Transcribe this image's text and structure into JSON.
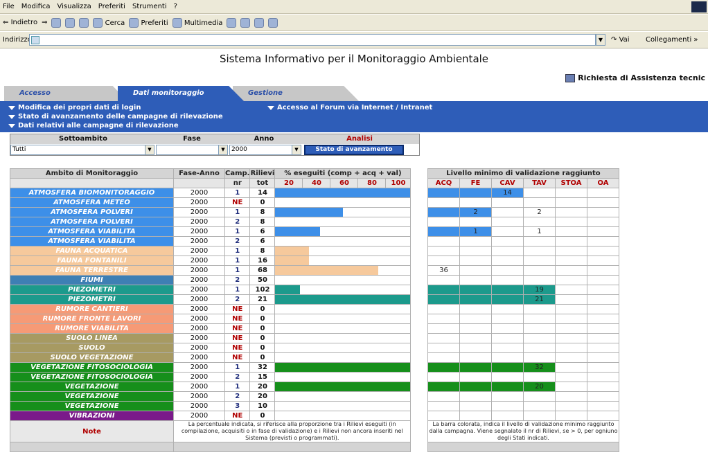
{
  "browser": {
    "menu": [
      "File",
      "Modifica",
      "Visualizza",
      "Preferiti",
      "Strumenti",
      "?"
    ],
    "toolbar": {
      "back": "Indietro",
      "search": "Cerca",
      "favorites": "Preferiti",
      "multimedia": "Multimedia"
    },
    "address_label": "Indirizzo",
    "go_label": "Vai",
    "links_label": "Collegamenti"
  },
  "site": {
    "title": "Sistema Informativo per il Monitoraggio Ambientale",
    "assistance": "Richiesta di Assistenza tecnic"
  },
  "tabs": [
    "Accesso",
    "Dati monitoraggio",
    "Gestione"
  ],
  "links": {
    "login": "Modifica dei propri dati di login",
    "stato": "Stato di avanzamento delle campagne di rilevazione",
    "dati": "Dati relativi alle campagne di rilevazione",
    "forum": "Accesso al Forum via Internet / Intranet"
  },
  "filters": {
    "sottoambito_label": "Sottoambito",
    "fase_label": "Fase",
    "anno_label": "Anno",
    "analisi_label": "Analisi",
    "sottoambito_value": "Tutti",
    "fase_value": "",
    "anno_value": "2000",
    "button": "Stato di avanzamento"
  },
  "table": {
    "headers": {
      "ambito": "Ambito di Monitoraggio",
      "fase_anno": "Fase-Anno",
      "camp": "Camp.",
      "rilievi": "Rilievi",
      "percent": "% eseguiti (comp + acq + val)",
      "nr": "nr",
      "tot": "tot",
      "ticks": [
        "20",
        "40",
        "60",
        "80",
        "100"
      ]
    },
    "right_headers": {
      "title": "Livello minimo di validazione raggiunto",
      "cols": [
        "ACQ",
        "FE",
        "CAV",
        "TAV",
        "STOA",
        "OA"
      ]
    },
    "rows": [
      {
        "ambito": "ATMOSFERA BIOMONITORAGGIO",
        "color": "#3d8fe8",
        "fase": "2000",
        "camp": "1",
        "tot": "14",
        "pct": 100,
        "barColor": "#3d8fe8",
        "level": 3,
        "levelColor": "#3d8fe8",
        "counts": [
          "",
          "",
          "14",
          "",
          "",
          ""
        ]
      },
      {
        "ambito": "ATMOSFERA METEO",
        "color": "#3d8fe8",
        "fase": "2000",
        "camp": "NE",
        "tot": "0",
        "pct": 0,
        "barColor": "#3d8fe8",
        "level": 0,
        "levelColor": "#3d8fe8",
        "counts": [
          "",
          "",
          "",
          "",
          "",
          ""
        ]
      },
      {
        "ambito": "ATMOSFERA POLVERI",
        "color": "#3d8fe8",
        "fase": "2000",
        "camp": "1",
        "tot": "8",
        "pct": 50,
        "barColor": "#3d8fe8",
        "level": 2,
        "levelColor": "#3d8fe8",
        "counts": [
          "",
          "2",
          "",
          "2",
          "",
          ""
        ]
      },
      {
        "ambito": "ATMOSFERA POLVERI",
        "color": "#3d8fe8",
        "fase": "2000",
        "camp": "2",
        "tot": "8",
        "pct": 0,
        "barColor": "#3d8fe8",
        "level": 0,
        "levelColor": "#3d8fe8",
        "counts": [
          "",
          "",
          "",
          "",
          "",
          ""
        ]
      },
      {
        "ambito": "ATMOSFERA VIABILITA",
        "color": "#3d8fe8",
        "fase": "2000",
        "camp": "1",
        "tot": "6",
        "pct": 33,
        "barColor": "#3d8fe8",
        "level": 2,
        "levelColor": "#3d8fe8",
        "counts": [
          "",
          "1",
          "",
          "1",
          "",
          ""
        ]
      },
      {
        "ambito": "ATMOSFERA VIABILITA",
        "color": "#3d8fe8",
        "fase": "2000",
        "camp": "2",
        "tot": "6",
        "pct": 0,
        "barColor": "#3d8fe8",
        "level": 0,
        "levelColor": "#3d8fe8",
        "counts": [
          "",
          "",
          "",
          "",
          "",
          ""
        ]
      },
      {
        "ambito": "FAUNA ACQUATICA",
        "color": "#f6c99c",
        "fase": "2000",
        "camp": "1",
        "tot": "8",
        "pct": 25,
        "barColor": "#f6c99c",
        "level": 0,
        "levelColor": "#f6c99c",
        "counts": [
          "",
          "",
          "",
          "",
          "",
          ""
        ]
      },
      {
        "ambito": "FAUNA FONTANILI",
        "color": "#f6c99c",
        "fase": "2000",
        "camp": "1",
        "tot": "16",
        "pct": 25,
        "barColor": "#f6c99c",
        "level": 0,
        "levelColor": "#f6c99c",
        "counts": [
          "",
          "",
          "",
          "",
          "",
          ""
        ]
      },
      {
        "ambito": "FAUNA TERRESTRE",
        "color": "#f6c99c",
        "fase": "2000",
        "camp": "1",
        "tot": "68",
        "pct": 76,
        "barColor": "#f6c99c",
        "level": 0,
        "levelColor": "#f6c99c",
        "counts": [
          "36",
          "",
          "",
          "",
          "",
          ""
        ]
      },
      {
        "ambito": "FIUMI",
        "color": "#3e7fb4",
        "fase": "2000",
        "camp": "2",
        "tot": "50",
        "pct": 0,
        "barColor": "#3e7fb4",
        "level": 0,
        "levelColor": "#3e7fb4",
        "counts": [
          "",
          "",
          "",
          "",
          "",
          ""
        ]
      },
      {
        "ambito": "PIEZOMETRI",
        "color": "#1c9a8c",
        "fase": "2000",
        "camp": "1",
        "tot": "102",
        "pct": 18,
        "barColor": "#1c9a8c",
        "level": 4,
        "levelColor": "#1c9a8c",
        "counts": [
          "",
          "",
          "",
          "19",
          "",
          ""
        ]
      },
      {
        "ambito": "PIEZOMETRI",
        "color": "#1c9a8c",
        "fase": "2000",
        "camp": "2",
        "tot": "21",
        "pct": 100,
        "barColor": "#1c9a8c",
        "level": 4,
        "levelColor": "#1c9a8c",
        "counts": [
          "",
          "",
          "",
          "21",
          "",
          ""
        ]
      },
      {
        "ambito": "RUMORE CANTIERI",
        "color": "#f69a76",
        "fase": "2000",
        "camp": "NE",
        "tot": "0",
        "pct": 0,
        "barColor": "#f69a76",
        "level": 0,
        "levelColor": "#f69a76",
        "counts": [
          "",
          "",
          "",
          "",
          "",
          ""
        ]
      },
      {
        "ambito": "RUMORE FRONTE LAVORI",
        "color": "#f69a76",
        "fase": "2000",
        "camp": "NE",
        "tot": "0",
        "pct": 0,
        "barColor": "#f69a76",
        "level": 0,
        "levelColor": "#f69a76",
        "counts": [
          "",
          "",
          "",
          "",
          "",
          ""
        ]
      },
      {
        "ambito": "RUMORE VIABILITA",
        "color": "#f69a76",
        "fase": "2000",
        "camp": "NE",
        "tot": "0",
        "pct": 0,
        "barColor": "#f69a76",
        "level": 0,
        "levelColor": "#f69a76",
        "counts": [
          "",
          "",
          "",
          "",
          "",
          ""
        ]
      },
      {
        "ambito": "SUOLO LINEA",
        "color": "#a79a62",
        "fase": "2000",
        "camp": "NE",
        "tot": "0",
        "pct": 0,
        "barColor": "#a79a62",
        "level": 0,
        "levelColor": "#a79a62",
        "counts": [
          "",
          "",
          "",
          "",
          "",
          ""
        ]
      },
      {
        "ambito": "SUOLO",
        "color": "#a79a62",
        "fase": "2000",
        "camp": "NE",
        "tot": "0",
        "pct": 0,
        "barColor": "#a79a62",
        "level": 0,
        "levelColor": "#a79a62",
        "counts": [
          "",
          "",
          "",
          "",
          "",
          ""
        ]
      },
      {
        "ambito": "SUOLO VEGETAZIONE",
        "color": "#a79a62",
        "fase": "2000",
        "camp": "NE",
        "tot": "0",
        "pct": 0,
        "barColor": "#a79a62",
        "level": 0,
        "levelColor": "#a79a62",
        "counts": [
          "",
          "",
          "",
          "",
          "",
          ""
        ]
      },
      {
        "ambito": "VEGETAZIONE FITOSOCIOLOGIA",
        "color": "#168f1b",
        "fase": "2000",
        "camp": "1",
        "tot": "32",
        "pct": 100,
        "barColor": "#168f1b",
        "level": 4,
        "levelColor": "#168f1b",
        "counts": [
          "",
          "",
          "",
          "32",
          "",
          ""
        ]
      },
      {
        "ambito": "VEGETAZIONE FITOSOCIOLOGIA",
        "color": "#168f1b",
        "fase": "2000",
        "camp": "2",
        "tot": "15",
        "pct": 0,
        "barColor": "#168f1b",
        "level": 0,
        "levelColor": "#168f1b",
        "counts": [
          "",
          "",
          "",
          "",
          "",
          ""
        ]
      },
      {
        "ambito": "VEGETAZIONE",
        "color": "#168f1b",
        "fase": "2000",
        "camp": "1",
        "tot": "20",
        "pct": 100,
        "barColor": "#168f1b",
        "level": 4,
        "levelColor": "#168f1b",
        "counts": [
          "",
          "",
          "",
          "20",
          "",
          ""
        ]
      },
      {
        "ambito": "VEGETAZIONE",
        "color": "#168f1b",
        "fase": "2000",
        "camp": "2",
        "tot": "20",
        "pct": 0,
        "barColor": "#168f1b",
        "level": 0,
        "levelColor": "#168f1b",
        "counts": [
          "",
          "",
          "",
          "",
          "",
          ""
        ]
      },
      {
        "ambito": "VEGETAZIONE",
        "color": "#168f1b",
        "fase": "2000",
        "camp": "3",
        "tot": "10",
        "pct": 0,
        "barColor": "#168f1b",
        "level": 0,
        "levelColor": "#168f1b",
        "counts": [
          "",
          "",
          "",
          "",
          "",
          ""
        ]
      },
      {
        "ambito": "VIBRAZIONI",
        "color": "#7a1a8a",
        "fase": "2000",
        "camp": "NE",
        "tot": "0",
        "pct": 0,
        "barColor": "#7a1a8a",
        "level": 0,
        "levelColor": "#7a1a8a",
        "counts": [
          "",
          "",
          "",
          "",
          "",
          ""
        ]
      }
    ],
    "note_label": "Note",
    "note_left": "La percentuale indicata, si riferisce alla proporzione tra i Rilievi eseguiti (in compilazione, acquisiti o in fase di validazione) e i Rilievi non ancora inseriti nel Sistema (previsti o programmati).",
    "note_right": "La barra colorata, indica il livello di validazione minimo raggiunto dalla campagna. Viene segnalato il nr di Rilievi, se > 0, per ogniuno degli Stati indicati."
  }
}
